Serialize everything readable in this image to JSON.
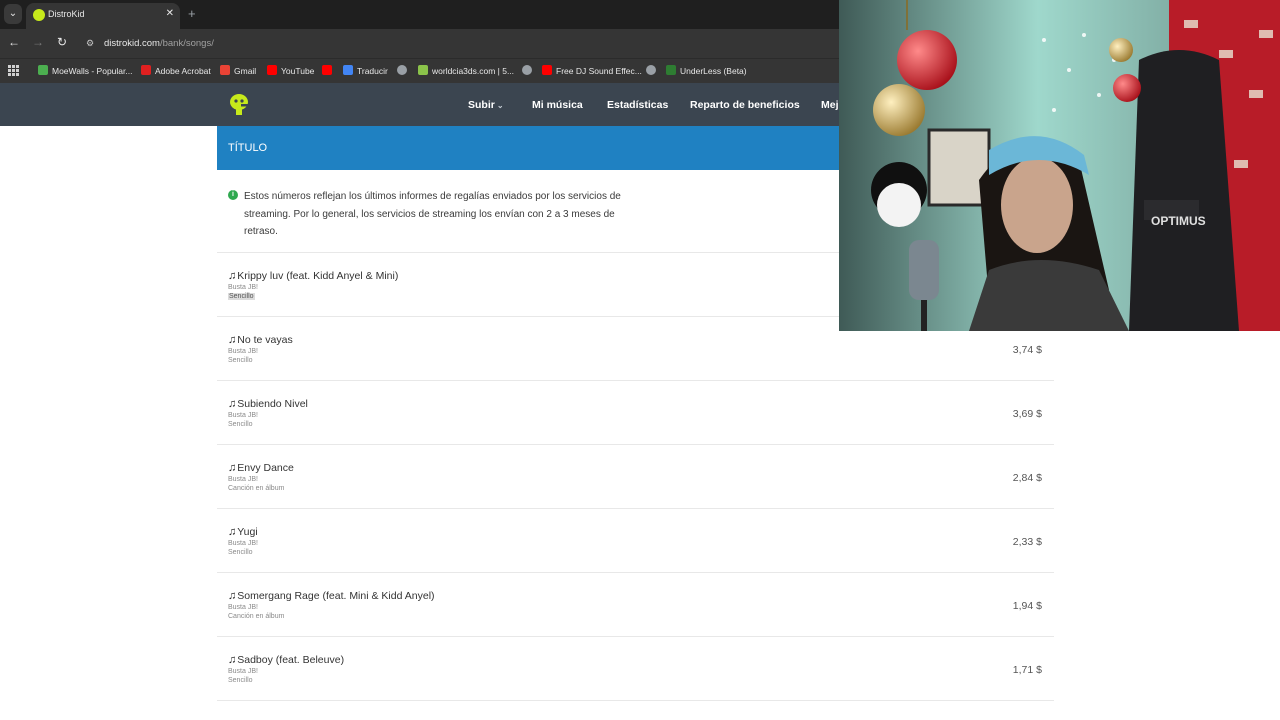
{
  "browser": {
    "tab_title": "DistroKid",
    "tab_close": "✕",
    "new_tab": "+",
    "url_host": "distrokid.com",
    "url_path": "/bank/songs/",
    "bookmarks": [
      {
        "label": "MoeWalls - Popular...",
        "color": "#4caf50"
      },
      {
        "label": "Adobe Acrobat",
        "color": "#e02020"
      },
      {
        "label": "Gmail",
        "color": "#ea4335"
      },
      {
        "label": "YouTube",
        "color": "#ff0000"
      },
      {
        "label": "Traducir",
        "color": "#4285f4"
      },
      {
        "label": "",
        "color": "#9aa0a6"
      },
      {
        "label": "worldcia3ds.com | 5...",
        "color": "#8bc34a"
      },
      {
        "label": "",
        "color": "#9aa0a6"
      },
      {
        "label": "Free DJ Sound Effec...",
        "color": "#ff0000"
      },
      {
        "label": "",
        "color": "#9aa0a6"
      },
      {
        "label": "UnderLess (Beta)",
        "color": "#2e7d32"
      }
    ]
  },
  "site": {
    "nav": [
      {
        "label": "Subir",
        "has_chevron": true
      },
      {
        "label": "Mi música",
        "has_chevron": false
      },
      {
        "label": "Estadísticas",
        "has_chevron": false
      },
      {
        "label": "Reparto de beneficios",
        "has_chevron": false
      },
      {
        "label": "Mej",
        "has_chevron": false
      }
    ],
    "accent": "#1f81c2",
    "header_bg": "#3b4550"
  },
  "main": {
    "column_title": "TÍTULO",
    "info_text": "Estos números reflejan los últimos informes de regalías enviados por los servicios de streaming. Por lo general, los servicios de streaming los envían con 2 a 3 meses de retraso.",
    "songs": [
      {
        "title": "Krippy luv (feat. Kidd Anyel & Mini)",
        "artist": "Busta JB!",
        "type": "Sencillo",
        "amount": ""
      },
      {
        "title": "No te vayas",
        "artist": "Busta JB!",
        "type": "Sencillo",
        "amount": "3,74 $"
      },
      {
        "title": "Subiendo Nivel",
        "artist": "Busta JB!",
        "type": "Sencillo",
        "amount": "3,69 $"
      },
      {
        "title": "Envy Dance",
        "artist": "Busta JB!",
        "type": "Canción en álbum",
        "amount": "2,84 $"
      },
      {
        "title": "Yugi",
        "artist": "Busta JB!",
        "type": "Sencillo",
        "amount": "2,33 $"
      },
      {
        "title": "Somergang Rage (feat. Mini & Kidd Anyel)",
        "artist": "Busta JB!",
        "type": "Canción en álbum",
        "amount": "1,94 $"
      },
      {
        "title": "Sadboy (feat. Beleuve)",
        "artist": "Busta JB!",
        "type": "Sencillo",
        "amount": "1,71 $"
      }
    ]
  },
  "webcam": {
    "chair_brand": "OPTIMUS"
  }
}
